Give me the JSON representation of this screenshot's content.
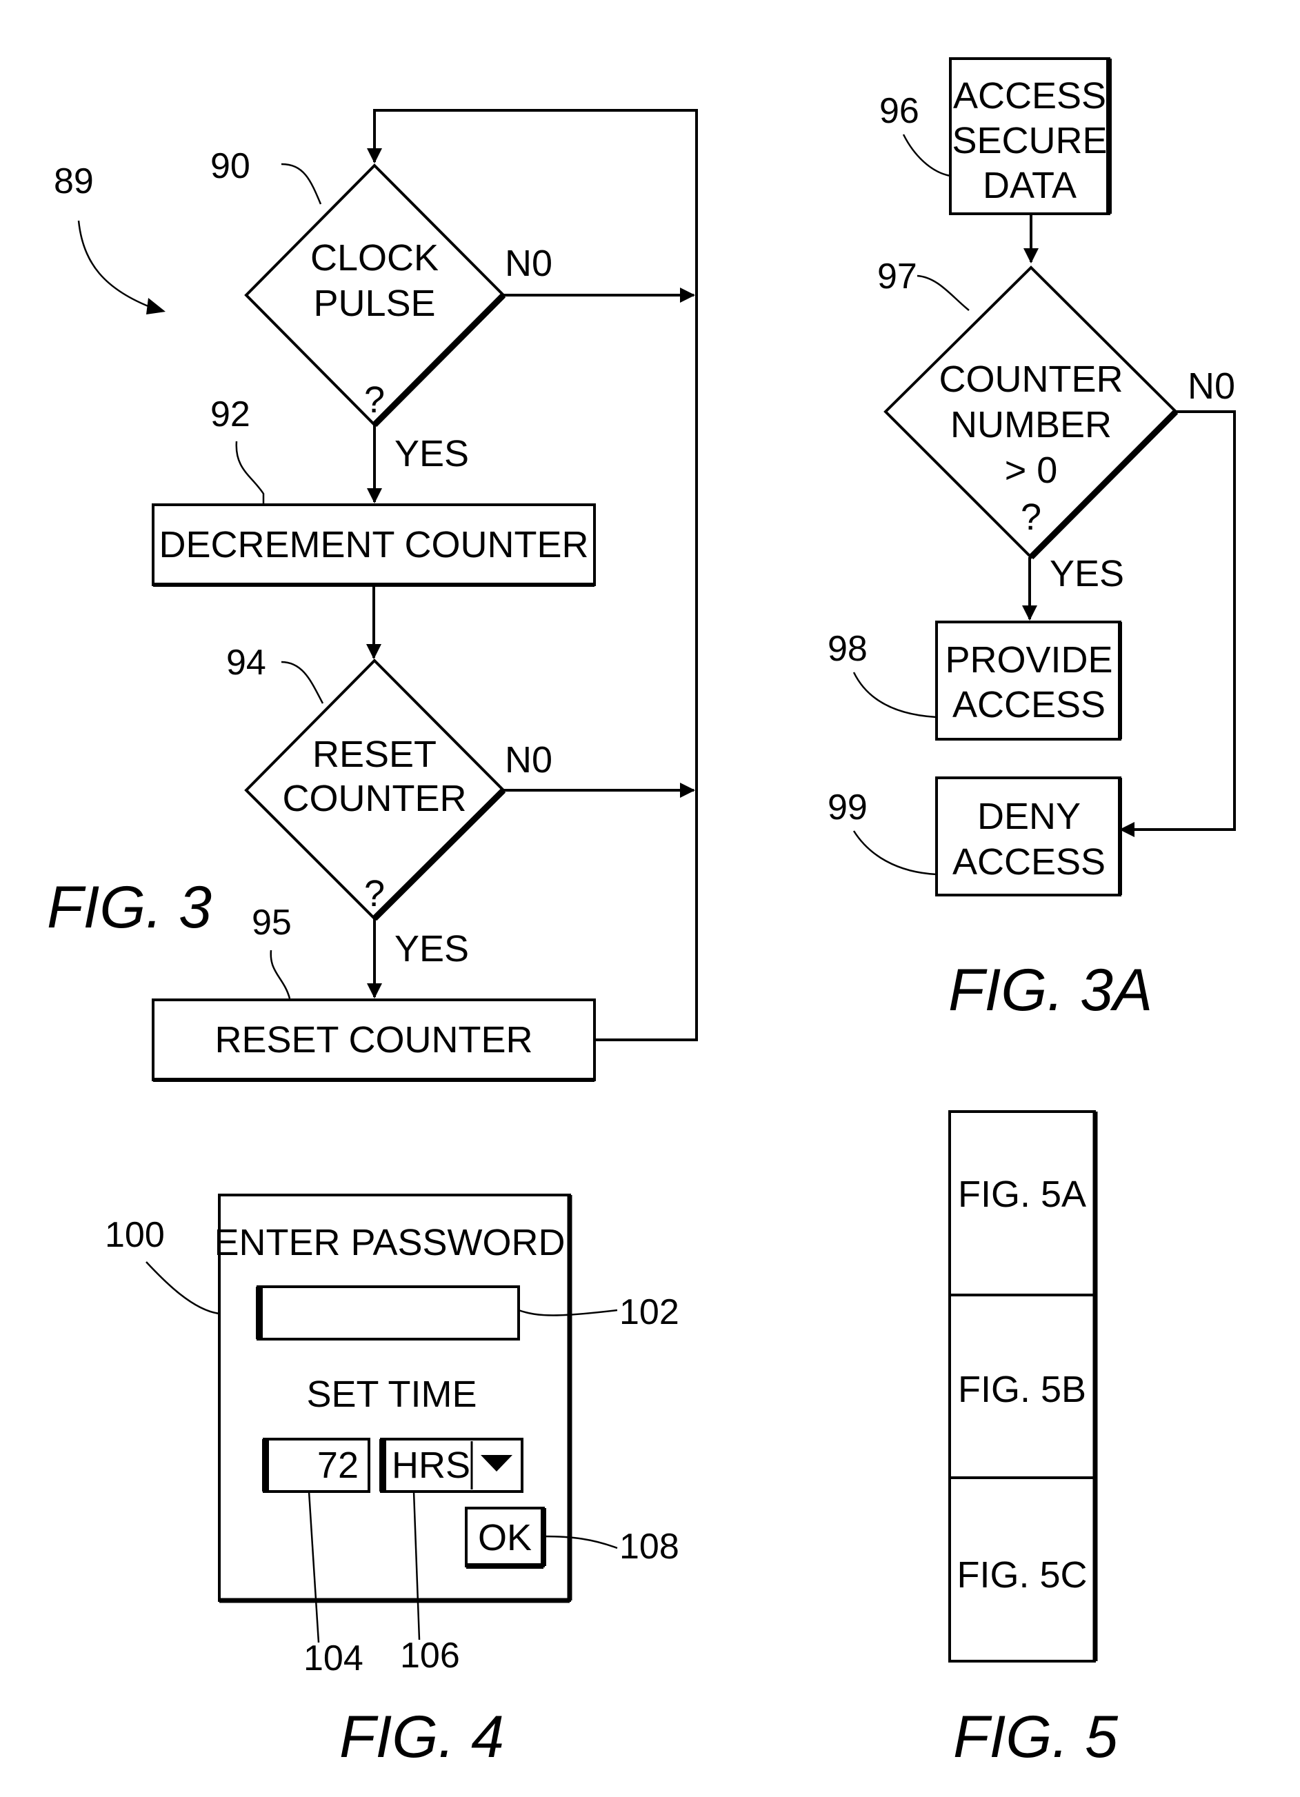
{
  "fig3": {
    "caption": "FIG. 3",
    "ref_main": "89",
    "decision_clock": {
      "ref": "90",
      "line1": "CLOCK",
      "line2": "PULSE",
      "q": "?",
      "no": "N0",
      "yes": "YES"
    },
    "process_decrement": {
      "ref": "92",
      "text": "DECREMENT COUNTER"
    },
    "decision_reset": {
      "ref": "94",
      "line1": "RESET",
      "line2": "COUNTER",
      "q": "?",
      "no": "N0",
      "yes": "YES"
    },
    "process_reset": {
      "ref": "95",
      "text": "RESET COUNTER"
    }
  },
  "fig3a": {
    "caption": "FIG. 3A",
    "access_box": {
      "ref": "96",
      "line1": "ACCESS",
      "line2": "SECURE",
      "line3": "DATA"
    },
    "decision": {
      "ref": "97",
      "line1": "COUNTER",
      "line2": "NUMBER",
      "line3": "> 0",
      "q": "?",
      "no": "N0",
      "yes": "YES"
    },
    "provide": {
      "ref": "98",
      "line1": "PROVIDE",
      "line2": "ACCESS"
    },
    "deny": {
      "ref": "99",
      "line1": "DENY",
      "line2": "ACCESS"
    }
  },
  "fig4": {
    "caption": "FIG. 4",
    "dialog_ref": "100",
    "title": "ENTER PASSWORD",
    "password_ref": "102",
    "password_value": "",
    "set_time_label": "SET TIME",
    "time_value": "72",
    "time_ref": "104",
    "unit_value": "HRS",
    "unit_ref": "106",
    "ok_label": "OK",
    "ok_ref": "108"
  },
  "fig5": {
    "caption": "FIG. 5",
    "panels": [
      "FIG. 5A",
      "FIG. 5B",
      "FIG. 5C"
    ]
  }
}
